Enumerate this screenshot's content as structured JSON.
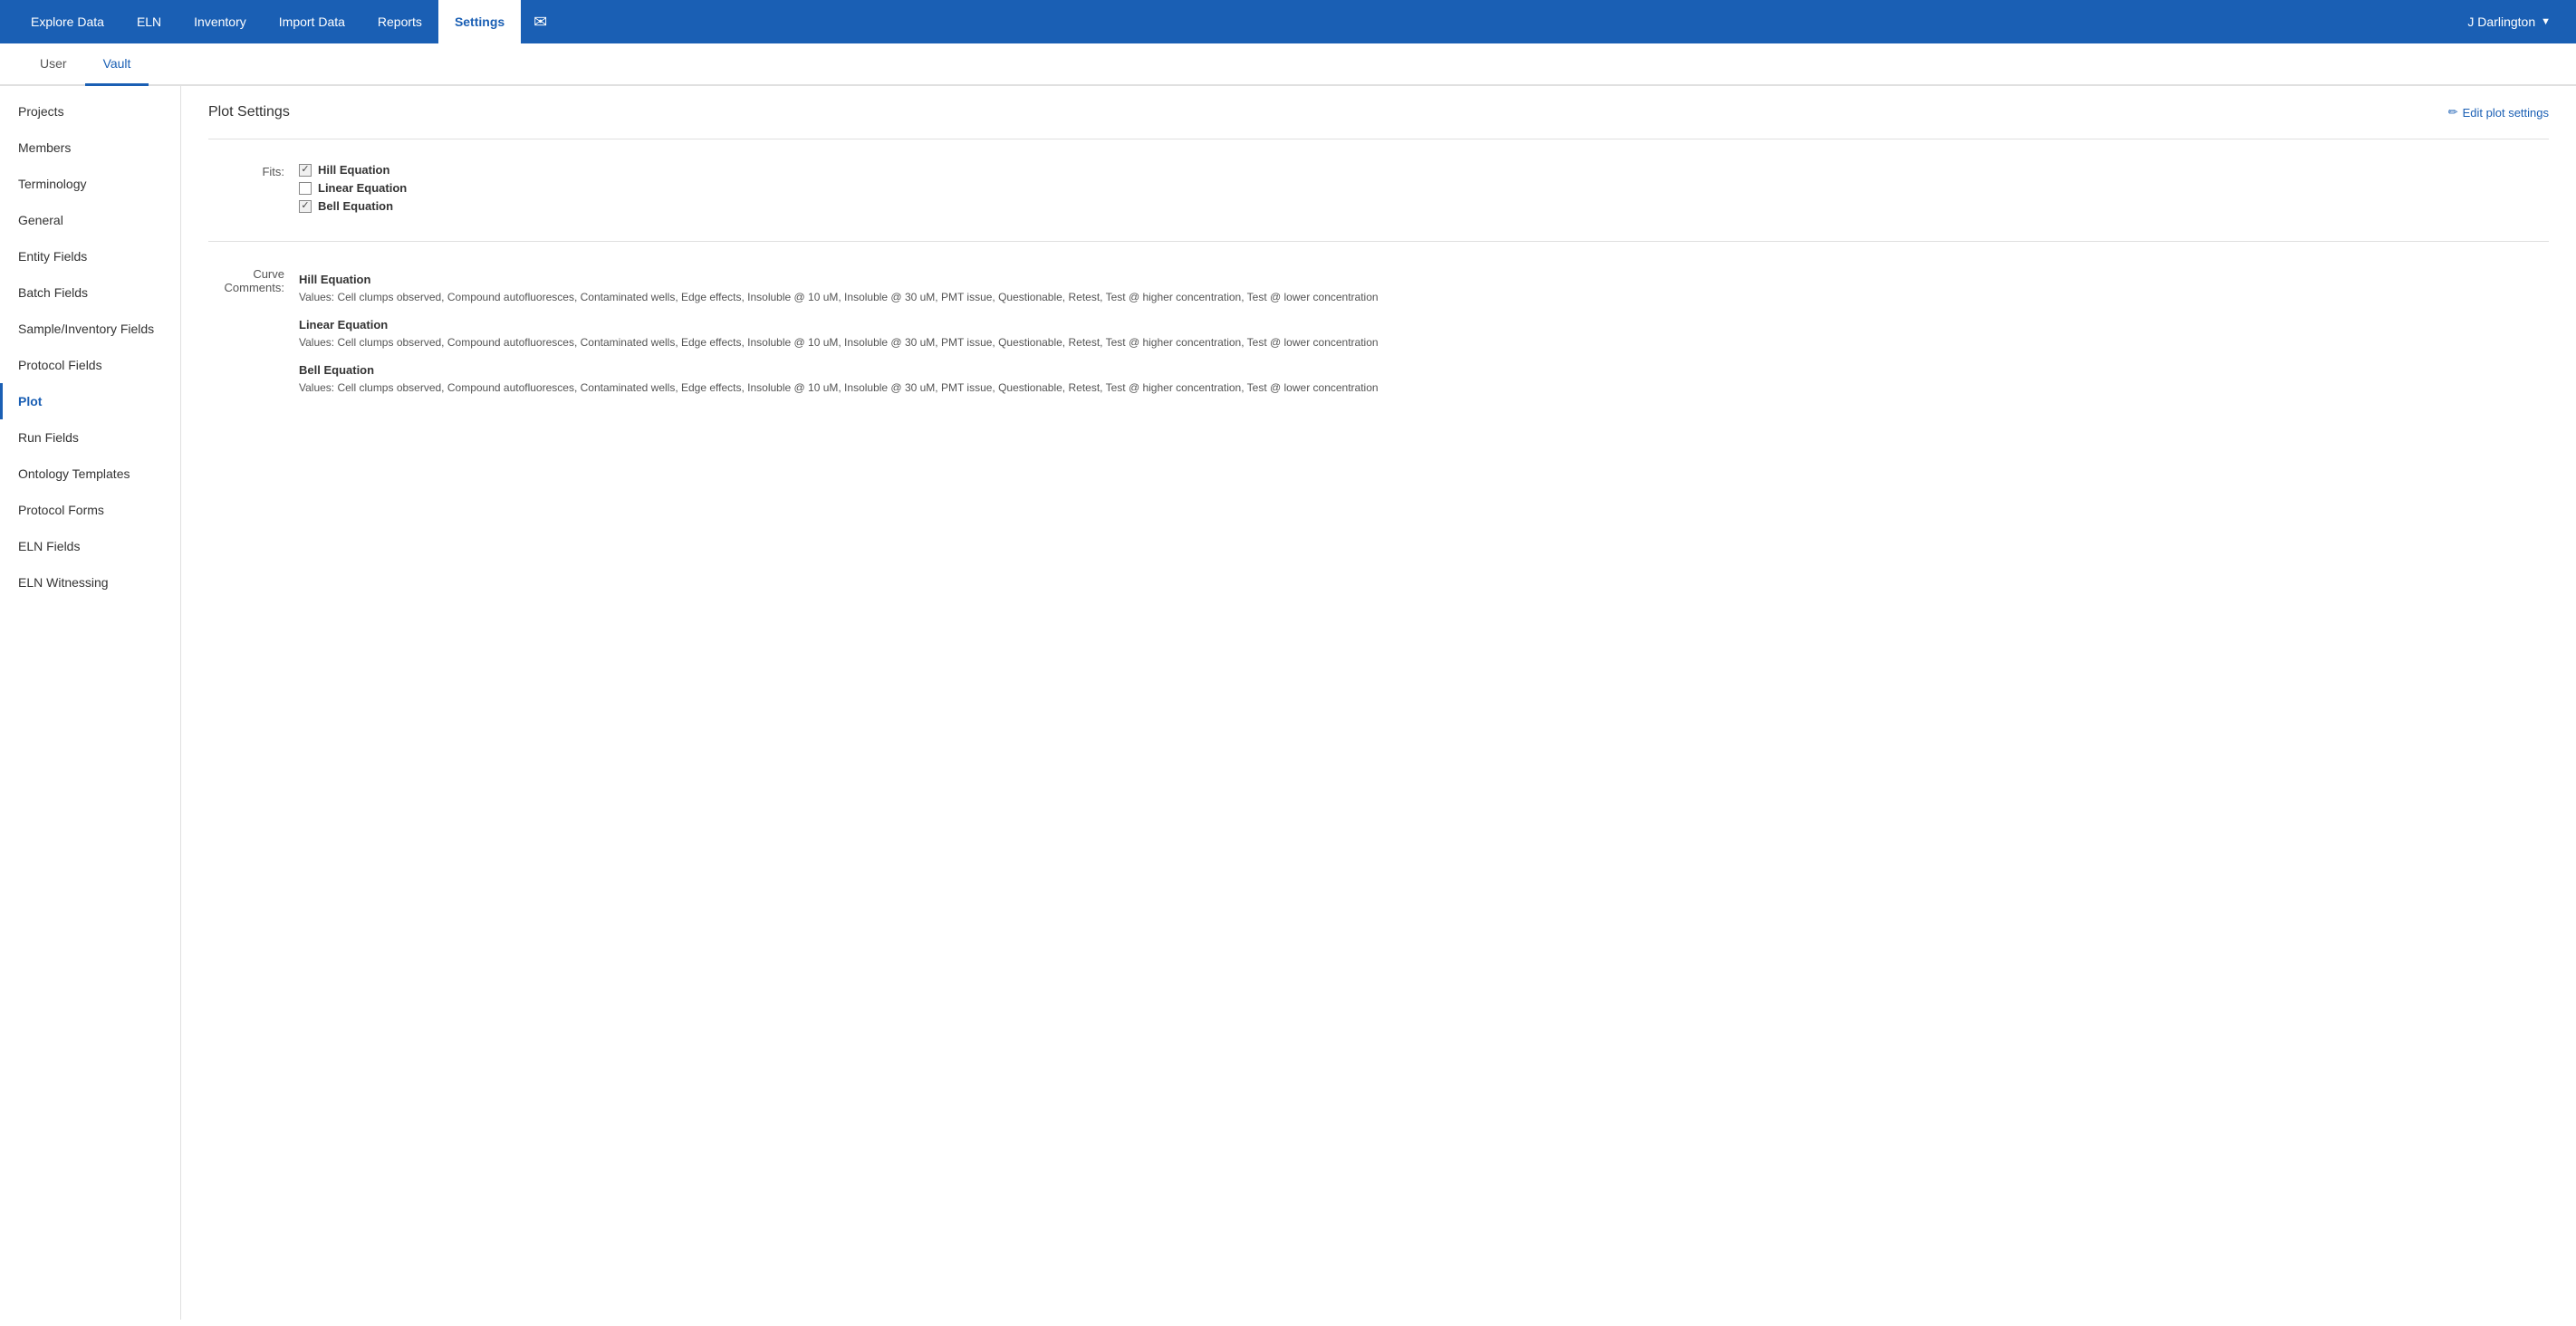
{
  "nav": {
    "items": [
      {
        "label": "Explore Data",
        "active": false
      },
      {
        "label": "ELN",
        "active": false
      },
      {
        "label": "Inventory",
        "active": false
      },
      {
        "label": "Import Data",
        "active": false
      },
      {
        "label": "Reports",
        "active": false
      },
      {
        "label": "Settings",
        "active": true
      }
    ],
    "mail_icon": "✉",
    "user_label": "J Darlington",
    "caret": "▼"
  },
  "sub_tabs": [
    {
      "label": "User",
      "active": false
    },
    {
      "label": "Vault",
      "active": true
    }
  ],
  "sidebar": {
    "items": [
      {
        "label": "Projects",
        "active": false
      },
      {
        "label": "Members",
        "active": false
      },
      {
        "label": "Terminology",
        "active": false
      },
      {
        "label": "General",
        "active": false
      },
      {
        "label": "Entity Fields",
        "active": false
      },
      {
        "label": "Batch Fields",
        "active": false
      },
      {
        "label": "Sample/Inventory Fields",
        "active": false
      },
      {
        "label": "Protocol Fields",
        "active": false
      },
      {
        "label": "Plot",
        "active": true
      },
      {
        "label": "Run Fields",
        "active": false
      },
      {
        "label": "Ontology Templates",
        "active": false
      },
      {
        "label": "Protocol Forms",
        "active": false
      },
      {
        "label": "ELN Fields",
        "active": false
      },
      {
        "label": "ELN Witnessing",
        "active": false
      }
    ]
  },
  "content": {
    "title": "Plot Settings",
    "edit_label": "Edit plot settings",
    "edit_icon": "✏",
    "fits_label": "Fits:",
    "fits": [
      {
        "label": "Hill Equation",
        "checked": true
      },
      {
        "label": "Linear Equation",
        "checked": false
      },
      {
        "label": "Bell Equation",
        "checked": true
      }
    ],
    "curve_comments_label": "Curve Comments:",
    "curve_comments": [
      {
        "title": "Hill Equation",
        "values": "Values: Cell clumps observed, Compound autofluoresces, Contaminated wells, Edge effects, Insoluble @ 10 uM, Insoluble @ 30 uM, PMT issue, Questionable, Retest, Test @ higher concentration, Test @ lower concentration"
      },
      {
        "title": "Linear Equation",
        "values": "Values: Cell clumps observed, Compound autofluoresces, Contaminated wells, Edge effects, Insoluble @ 10 uM, Insoluble @ 30 uM, PMT issue, Questionable, Retest, Test @ higher concentration, Test @ lower concentration"
      },
      {
        "title": "Bell Equation",
        "values": "Values: Cell clumps observed, Compound autofluoresces, Contaminated wells, Edge effects, Insoluble @ 10 uM, Insoluble @ 30 uM, PMT issue, Questionable, Retest, Test @ higher concentration, Test @ lower concentration"
      }
    ]
  }
}
